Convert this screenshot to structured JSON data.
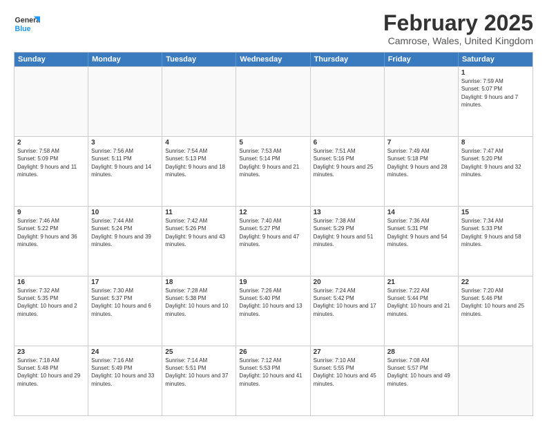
{
  "header": {
    "logo_general": "General",
    "logo_blue": "Blue",
    "main_title": "February 2025",
    "subtitle": "Camrose, Wales, United Kingdom"
  },
  "calendar": {
    "days": [
      "Sunday",
      "Monday",
      "Tuesday",
      "Wednesday",
      "Thursday",
      "Friday",
      "Saturday"
    ],
    "rows": [
      [
        {
          "num": "",
          "empty": true
        },
        {
          "num": "",
          "empty": true
        },
        {
          "num": "",
          "empty": true
        },
        {
          "num": "",
          "empty": true
        },
        {
          "num": "",
          "empty": true
        },
        {
          "num": "",
          "empty": true
        },
        {
          "num": "1",
          "text": "Sunrise: 7:59 AM\nSunset: 5:07 PM\nDaylight: 9 hours and 7 minutes."
        }
      ],
      [
        {
          "num": "2",
          "text": "Sunrise: 7:58 AM\nSunset: 5:09 PM\nDaylight: 9 hours and 11 minutes."
        },
        {
          "num": "3",
          "text": "Sunrise: 7:56 AM\nSunset: 5:11 PM\nDaylight: 9 hours and 14 minutes."
        },
        {
          "num": "4",
          "text": "Sunrise: 7:54 AM\nSunset: 5:13 PM\nDaylight: 9 hours and 18 minutes."
        },
        {
          "num": "5",
          "text": "Sunrise: 7:53 AM\nSunset: 5:14 PM\nDaylight: 9 hours and 21 minutes."
        },
        {
          "num": "6",
          "text": "Sunrise: 7:51 AM\nSunset: 5:16 PM\nDaylight: 9 hours and 25 minutes."
        },
        {
          "num": "7",
          "text": "Sunrise: 7:49 AM\nSunset: 5:18 PM\nDaylight: 9 hours and 28 minutes."
        },
        {
          "num": "8",
          "text": "Sunrise: 7:47 AM\nSunset: 5:20 PM\nDaylight: 9 hours and 32 minutes."
        }
      ],
      [
        {
          "num": "9",
          "text": "Sunrise: 7:46 AM\nSunset: 5:22 PM\nDaylight: 9 hours and 36 minutes."
        },
        {
          "num": "10",
          "text": "Sunrise: 7:44 AM\nSunset: 5:24 PM\nDaylight: 9 hours and 39 minutes."
        },
        {
          "num": "11",
          "text": "Sunrise: 7:42 AM\nSunset: 5:26 PM\nDaylight: 9 hours and 43 minutes."
        },
        {
          "num": "12",
          "text": "Sunrise: 7:40 AM\nSunset: 5:27 PM\nDaylight: 9 hours and 47 minutes."
        },
        {
          "num": "13",
          "text": "Sunrise: 7:38 AM\nSunset: 5:29 PM\nDaylight: 9 hours and 51 minutes."
        },
        {
          "num": "14",
          "text": "Sunrise: 7:36 AM\nSunset: 5:31 PM\nDaylight: 9 hours and 54 minutes."
        },
        {
          "num": "15",
          "text": "Sunrise: 7:34 AM\nSunset: 5:33 PM\nDaylight: 9 hours and 58 minutes."
        }
      ],
      [
        {
          "num": "16",
          "text": "Sunrise: 7:32 AM\nSunset: 5:35 PM\nDaylight: 10 hours and 2 minutes."
        },
        {
          "num": "17",
          "text": "Sunrise: 7:30 AM\nSunset: 5:37 PM\nDaylight: 10 hours and 6 minutes."
        },
        {
          "num": "18",
          "text": "Sunrise: 7:28 AM\nSunset: 5:38 PM\nDaylight: 10 hours and 10 minutes."
        },
        {
          "num": "19",
          "text": "Sunrise: 7:26 AM\nSunset: 5:40 PM\nDaylight: 10 hours and 13 minutes."
        },
        {
          "num": "20",
          "text": "Sunrise: 7:24 AM\nSunset: 5:42 PM\nDaylight: 10 hours and 17 minutes."
        },
        {
          "num": "21",
          "text": "Sunrise: 7:22 AM\nSunset: 5:44 PM\nDaylight: 10 hours and 21 minutes."
        },
        {
          "num": "22",
          "text": "Sunrise: 7:20 AM\nSunset: 5:46 PM\nDaylight: 10 hours and 25 minutes."
        }
      ],
      [
        {
          "num": "23",
          "text": "Sunrise: 7:18 AM\nSunset: 5:48 PM\nDaylight: 10 hours and 29 minutes."
        },
        {
          "num": "24",
          "text": "Sunrise: 7:16 AM\nSunset: 5:49 PM\nDaylight: 10 hours and 33 minutes."
        },
        {
          "num": "25",
          "text": "Sunrise: 7:14 AM\nSunset: 5:51 PM\nDaylight: 10 hours and 37 minutes."
        },
        {
          "num": "26",
          "text": "Sunrise: 7:12 AM\nSunset: 5:53 PM\nDaylight: 10 hours and 41 minutes."
        },
        {
          "num": "27",
          "text": "Sunrise: 7:10 AM\nSunset: 5:55 PM\nDaylight: 10 hours and 45 minutes."
        },
        {
          "num": "28",
          "text": "Sunrise: 7:08 AM\nSunset: 5:57 PM\nDaylight: 10 hours and 49 minutes."
        },
        {
          "num": "",
          "empty": true
        }
      ]
    ]
  }
}
